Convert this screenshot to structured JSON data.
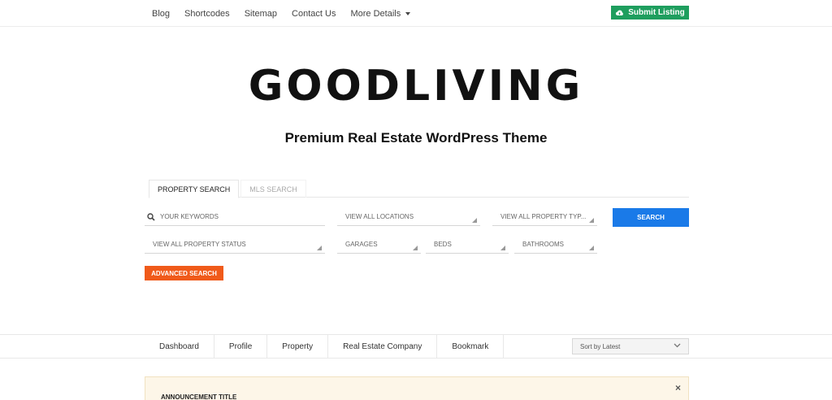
{
  "topnav": {
    "links": [
      "Blog",
      "Shortcodes",
      "Sitemap",
      "Contact Us"
    ],
    "more_label": "More Details",
    "submit_label": "Submit Listing"
  },
  "brand": {
    "logo_text": "GOODLIVING",
    "tagline": "Premium Real Estate WordPress Theme"
  },
  "search": {
    "tabs": [
      "PROPERTY SEARCH",
      "MLS SEARCH"
    ],
    "keywords_placeholder": "YOUR KEYWORDS",
    "locations": "VIEW ALL LOCATIONS",
    "property_types": "VIEW ALL PROPERTY TYP...",
    "search_label": "SEARCH",
    "property_status": "VIEW ALL PROPERTY STATUS",
    "garages": "GARAGES",
    "beds": "BEDS",
    "bathrooms": "BATHROOMS",
    "advanced_label": "ADVANCED SEARCH"
  },
  "dashboard": {
    "tabs": [
      "Dashboard",
      "Profile",
      "Property",
      "Real Estate Company",
      "Bookmark"
    ],
    "sort_value": "Sort by Latest"
  },
  "announcement": {
    "title": "ANNOUNCEMENT TITLE",
    "close_symbol": "×"
  },
  "colors": {
    "submit_green": "#1e9e5e",
    "search_blue": "#1a7ae8",
    "advanced_orange": "#f05a1a",
    "announcement_bg": "#fdf6e8"
  }
}
